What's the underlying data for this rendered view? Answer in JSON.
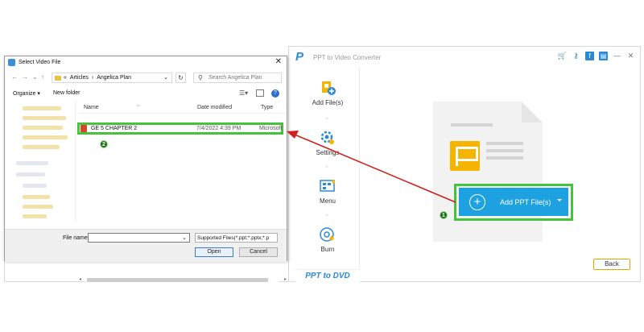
{
  "app": {
    "title": "PPT to Video Converter",
    "logo_letter": "P",
    "sidebar": [
      {
        "label": "Add File(s)",
        "icon": "add-file-icon"
      },
      {
        "label": "Settings",
        "icon": "settings-icon"
      },
      {
        "label": "Menu",
        "icon": "menu-icon"
      },
      {
        "label": "Burn",
        "icon": "burn-disc-icon"
      }
    ],
    "brand": "PPT to DVD",
    "add_button_label": "Add PPT File(s)",
    "back_label": "Back",
    "step1": "1",
    "accent_color": "#1da1e0"
  },
  "dialog": {
    "title": "Select Video File",
    "close": "✕",
    "crumb_prefix": "«",
    "crumbs": [
      "Articles",
      "Angelica Plan"
    ],
    "search_placeholder": "Search Angelica Plan",
    "organize": "Organize ▾",
    "new_folder": "New folder",
    "columns": {
      "name": "Name",
      "date": "Date modified",
      "type": "Type"
    },
    "file": {
      "name": "GE 5 CHAPTER 2",
      "date": "7/4/2022 4:39 PM",
      "type": "Microsoft"
    },
    "step2": "2",
    "file_name_label": "File name:",
    "file_name_value": "",
    "filter": "Supported Files(*.ppt;*.pptx;*.p",
    "open": "Open",
    "cancel": "Cancel"
  },
  "highlight_color": "#46c33c"
}
